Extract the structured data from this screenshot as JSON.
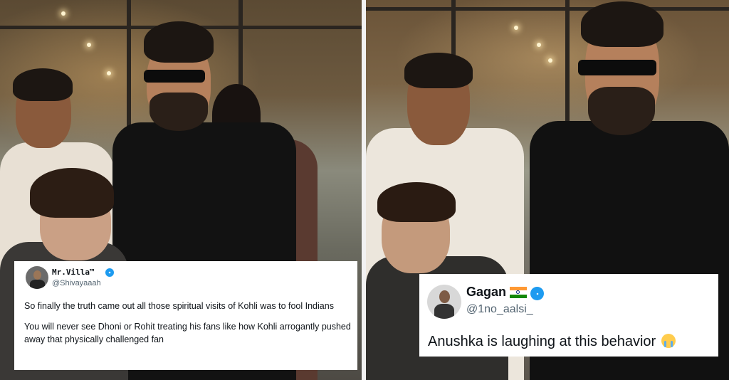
{
  "left_tweet": {
    "display_name": "Mr.Villa™",
    "handle": "@Shivayaaah",
    "paragraphs": [
      "So finally the truth came out all those spiritual visits of Kohli was to fool Indians",
      "You will never see Dhoni or Rohit treating his fans like how Kohli arrogantly pushed away that physically challenged fan"
    ],
    "verified": true
  },
  "right_tweet": {
    "display_name": "Gagan",
    "handle": "@1no_aalsi_",
    "text": "Anushka is laughing at this behavior",
    "verified": true,
    "emoji": "loudly-crying-face"
  },
  "colors": {
    "verified_blue": "#1d9bf0",
    "handle_gray": "#536471",
    "text_dark": "#0f1419"
  }
}
